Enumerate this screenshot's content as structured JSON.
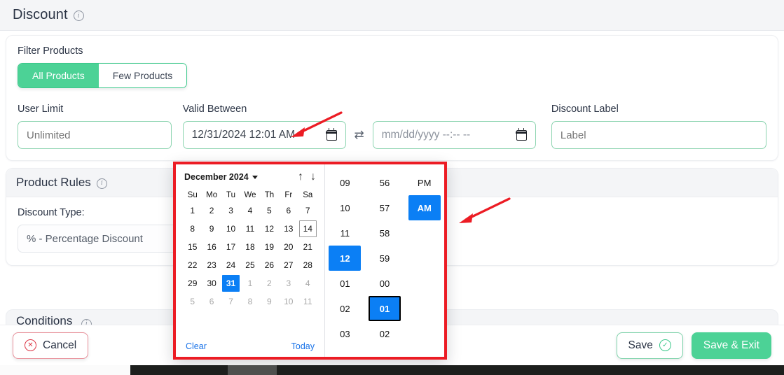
{
  "header": {
    "title": "Discount",
    "info_icon": "info-icon"
  },
  "filter": {
    "label": "Filter Products",
    "options": [
      "All Products",
      "Few Products"
    ],
    "selected": "All Products"
  },
  "fields": {
    "user_limit": {
      "label": "User Limit",
      "value": "",
      "placeholder": "Unlimited"
    },
    "valid_between": {
      "label": "Valid Between",
      "start_value": "12/31/2024 12:01 AM",
      "end_value": "",
      "end_placeholder": "mm/dd/yyyy --:-- --",
      "swap_icon": "swap-arrows-icon"
    },
    "discount_label": {
      "label": "Discount Label",
      "value": "",
      "placeholder": "Label"
    }
  },
  "product_rules": {
    "title": "Product Rules",
    "discount_type_label": "Discount Type:",
    "discount_type_value": "% - Percentage Discount"
  },
  "conditions": {
    "title": "Conditions"
  },
  "footer": {
    "cancel_label": "Cancel",
    "save_label": "Save",
    "save_exit_label": "Save & Exit"
  },
  "datepicker": {
    "month_label": "December 2024",
    "nav_up": "↑",
    "nav_down": "↓",
    "weekdays": [
      "Su",
      "Mo",
      "Tu",
      "We",
      "Th",
      "Fr",
      "Sa"
    ],
    "weeks": [
      [
        {
          "d": "1",
          "s": "cur"
        },
        {
          "d": "2",
          "s": "cur"
        },
        {
          "d": "3",
          "s": "cur"
        },
        {
          "d": "4",
          "s": "cur"
        },
        {
          "d": "5",
          "s": "cur"
        },
        {
          "d": "6",
          "s": "cur"
        },
        {
          "d": "7",
          "s": "cur"
        }
      ],
      [
        {
          "d": "8",
          "s": "cur"
        },
        {
          "d": "9",
          "s": "cur"
        },
        {
          "d": "10",
          "s": "cur"
        },
        {
          "d": "11",
          "s": "cur"
        },
        {
          "d": "12",
          "s": "cur"
        },
        {
          "d": "13",
          "s": "cur"
        },
        {
          "d": "14",
          "s": "today"
        }
      ],
      [
        {
          "d": "15",
          "s": "cur"
        },
        {
          "d": "16",
          "s": "cur"
        },
        {
          "d": "17",
          "s": "cur"
        },
        {
          "d": "18",
          "s": "cur"
        },
        {
          "d": "19",
          "s": "cur"
        },
        {
          "d": "20",
          "s": "cur"
        },
        {
          "d": "21",
          "s": "cur"
        }
      ],
      [
        {
          "d": "22",
          "s": "cur"
        },
        {
          "d": "23",
          "s": "cur"
        },
        {
          "d": "24",
          "s": "cur"
        },
        {
          "d": "25",
          "s": "cur"
        },
        {
          "d": "26",
          "s": "cur"
        },
        {
          "d": "27",
          "s": "cur"
        },
        {
          "d": "28",
          "s": "cur"
        }
      ],
      [
        {
          "d": "29",
          "s": "cur"
        },
        {
          "d": "30",
          "s": "cur"
        },
        {
          "d": "31",
          "s": "selected"
        },
        {
          "d": "1",
          "s": "muted"
        },
        {
          "d": "2",
          "s": "muted"
        },
        {
          "d": "3",
          "s": "muted"
        },
        {
          "d": "4",
          "s": "muted"
        }
      ],
      [
        {
          "d": "5",
          "s": "muted"
        },
        {
          "d": "6",
          "s": "muted"
        },
        {
          "d": "7",
          "s": "muted"
        },
        {
          "d": "8",
          "s": "muted"
        },
        {
          "d": "9",
          "s": "muted"
        },
        {
          "d": "10",
          "s": "muted"
        },
        {
          "d": "11",
          "s": "muted"
        }
      ]
    ],
    "clear_label": "Clear",
    "today_label": "Today",
    "time": {
      "hours": [
        {
          "v": "09",
          "s": "normal"
        },
        {
          "v": "10",
          "s": "normal"
        },
        {
          "v": "11",
          "s": "normal"
        },
        {
          "v": "12",
          "s": "selected"
        },
        {
          "v": "01",
          "s": "normal"
        },
        {
          "v": "02",
          "s": "normal"
        },
        {
          "v": "03",
          "s": "normal"
        }
      ],
      "minutes": [
        {
          "v": "56",
          "s": "normal"
        },
        {
          "v": "57",
          "s": "normal"
        },
        {
          "v": "58",
          "s": "normal"
        },
        {
          "v": "59",
          "s": "normal"
        },
        {
          "v": "00",
          "s": "normal"
        },
        {
          "v": "01",
          "s": "selected-focus"
        },
        {
          "v": "02",
          "s": "normal"
        }
      ],
      "meridiem": [
        {
          "v": "PM",
          "s": "normal"
        },
        {
          "v": "AM",
          "s": "selected"
        }
      ]
    }
  },
  "colors": {
    "accent_green": "#4cd296",
    "picker_highlight_blue": "#0b7ff5",
    "annotation_red": "#ec1c24",
    "link_blue": "#1a73e8",
    "cancel_red": "#dc3545"
  }
}
